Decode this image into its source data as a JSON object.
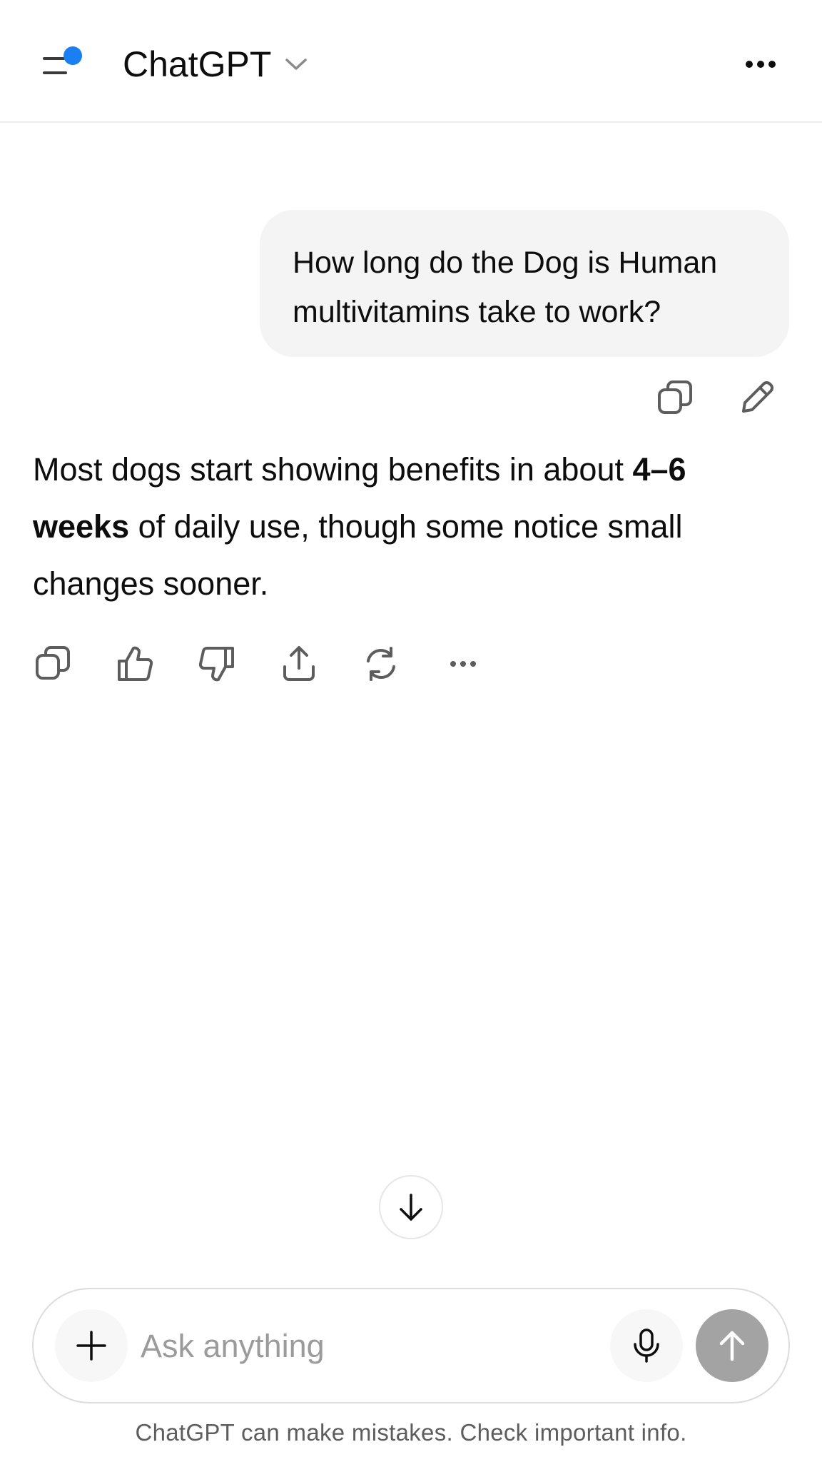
{
  "header": {
    "title": "ChatGPT",
    "menu_icon": "sidebar-menu-icon",
    "notification_dot_color": "#1a7ff0",
    "dropdown_icon": "chevron-down-icon",
    "more_icon": "more-horizontal-icon"
  },
  "conversation": {
    "user_message": {
      "line1": "How long do the Dog is Human",
      "line2": "multivitamins take to work?",
      "actions": [
        "copy-icon",
        "edit-pencil-icon"
      ]
    },
    "assistant_message": {
      "part1": "Most dogs start showing benefits in about ",
      "bold": "4–6 weeks",
      "part2": " of daily use, though some notice small changes sooner.",
      "actions": [
        "copy-icon",
        "thumbs-up-icon",
        "thumbs-down-icon",
        "share-icon",
        "regenerate-icon",
        "more-horizontal-icon"
      ]
    }
  },
  "scroll_down_icon": "arrow-down-icon",
  "composer": {
    "placeholder": "Ask anything",
    "plus_icon": "plus-icon",
    "mic_icon": "microphone-icon",
    "send_icon": "arrow-up-icon",
    "send_button_color": "#a3a3a3"
  },
  "disclaimer": "ChatGPT can make mistakes. Check important info."
}
